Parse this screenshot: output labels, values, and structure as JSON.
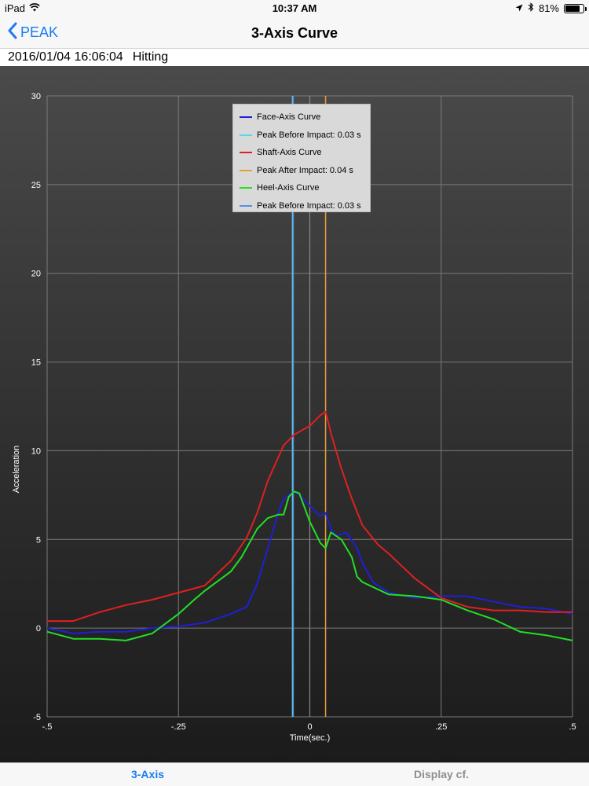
{
  "status_bar": {
    "device": "iPad",
    "time": "10:37 AM",
    "battery_text": "81%",
    "battery_level": 0.81
  },
  "nav": {
    "back_label": "PEAK",
    "title": "3-Axis Curve"
  },
  "info": {
    "datetime": "2016/01/04 16:06:04",
    "mode": "Hitting"
  },
  "chart_data": {
    "type": "line",
    "xlabel": "Time(sec.)",
    "ylabel": "Acceleration",
    "xlim": [
      -0.5,
      0.5
    ],
    "ylim": [
      -5,
      30
    ],
    "x_ticks": [
      -0.5,
      -0.25,
      0,
      0.25,
      0.5
    ],
    "x_tick_labels": [
      "-.5",
      "-.25",
      "0",
      ".25",
      ".5"
    ],
    "y_ticks": [
      -5,
      0,
      5,
      10,
      15,
      20,
      25,
      30
    ],
    "y_tick_labels": [
      "-5",
      "0",
      "5",
      "10",
      "15",
      "20",
      "25",
      "30"
    ],
    "grid": true,
    "legend_position": "top-center",
    "series": [
      {
        "name": "Face-Axis Curve",
        "color": "#1f1fd6",
        "x": [
          -0.5,
          -0.45,
          -0.4,
          -0.35,
          -0.3,
          -0.25,
          -0.2,
          -0.15,
          -0.12,
          -0.1,
          -0.08,
          -0.06,
          -0.05,
          -0.03,
          -0.02,
          0,
          0.02,
          0.03,
          0.04,
          0.05,
          0.07,
          0.09,
          0.1,
          0.12,
          0.15,
          0.2,
          0.25,
          0.3,
          0.35,
          0.4,
          0.45,
          0.5
        ],
        "y": [
          0,
          -0.3,
          -0.2,
          -0.2,
          0,
          0.1,
          0.3,
          0.8,
          1.2,
          2.5,
          4.5,
          6.5,
          7.3,
          7.7,
          7.5,
          6.9,
          6.3,
          6.5,
          5.6,
          5.2,
          5.4,
          4.5,
          3.7,
          2.6,
          2,
          1.7,
          1.8,
          1.8,
          1.5,
          1.2,
          1.1,
          0.8
        ]
      },
      {
        "name": "Shaft-Axis Curve",
        "color": "#e02020",
        "x": [
          -0.5,
          -0.45,
          -0.4,
          -0.35,
          -0.3,
          -0.25,
          -0.2,
          -0.15,
          -0.12,
          -0.1,
          -0.08,
          -0.05,
          -0.03,
          0,
          0.02,
          0.03,
          0.04,
          0.06,
          0.08,
          0.1,
          0.13,
          0.15,
          0.2,
          0.25,
          0.3,
          0.35,
          0.4,
          0.45,
          0.5
        ],
        "y": [
          0.4,
          0.4,
          0.9,
          1.3,
          1.6,
          2,
          2.4,
          3.8,
          5.1,
          6.5,
          8.3,
          10.3,
          10.9,
          11.4,
          12,
          12.2,
          11,
          9,
          7.3,
          5.8,
          4.7,
          4.2,
          2.8,
          1.7,
          1.2,
          1,
          1,
          0.9,
          0.9
        ]
      },
      {
        "name": "Heel-Axis Curve",
        "color": "#22e022",
        "x": [
          -0.5,
          -0.45,
          -0.4,
          -0.35,
          -0.3,
          -0.25,
          -0.22,
          -0.2,
          -0.15,
          -0.13,
          -0.1,
          -0.08,
          -0.06,
          -0.05,
          -0.04,
          -0.03,
          -0.02,
          0,
          0.02,
          0.03,
          0.04,
          0.06,
          0.08,
          0.09,
          0.1,
          0.15,
          0.2,
          0.25,
          0.3,
          0.35,
          0.4,
          0.45,
          0.5
        ],
        "y": [
          -0.2,
          -0.6,
          -0.6,
          -0.7,
          -0.3,
          0.8,
          1.6,
          2.1,
          3.2,
          4,
          5.6,
          6.2,
          6.4,
          6.4,
          7.4,
          7.7,
          7.6,
          6,
          4.8,
          4.5,
          5.4,
          5,
          4,
          2.9,
          2.6,
          1.9,
          1.8,
          1.6,
          1,
          0.5,
          -0.2,
          -0.4,
          -0.7
        ]
      }
    ],
    "markers": [
      {
        "name": "Peak Before Impact: 0.03 s",
        "x": -0.033,
        "color": "#5ad7e8"
      },
      {
        "name": "Peak After Impact: 0.04 s",
        "x": 0.03,
        "color": "#e89c3a"
      },
      {
        "name": "Peak Before Impact: 0.03 s",
        "x": -0.033,
        "color": "#5a8fe0"
      }
    ],
    "zero_line": {
      "x": 0,
      "color": "#8a8a8a"
    }
  },
  "tabs": [
    {
      "label": "3-Axis",
      "active": true
    },
    {
      "label": "Display cf.",
      "active": false
    }
  ]
}
